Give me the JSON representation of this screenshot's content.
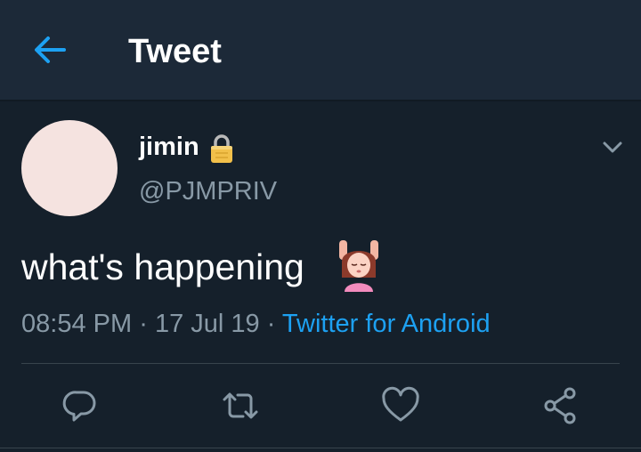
{
  "header": {
    "title": "Tweet",
    "back_icon": "arrow-left-icon"
  },
  "tweet": {
    "author": {
      "display_name": "jimin",
      "handle": "@PJMPRIV",
      "protected_icon": "lock-icon"
    },
    "text": "what's happening",
    "emoji": "person-getting-massage-emoji",
    "time": "08:54 PM",
    "separator": "·",
    "date": "17 Jul 19",
    "source": "Twitter for Android",
    "menu_icon": "chevron-down-icon"
  },
  "actions": {
    "reply_icon": "reply-icon",
    "retweet_icon": "retweet-icon",
    "like_icon": "heart-icon",
    "share_icon": "share-icon"
  },
  "colors": {
    "background": "#15202b",
    "header_background": "#1c2938",
    "accent": "#1da1f2",
    "secondary_text": "#8899a6"
  }
}
